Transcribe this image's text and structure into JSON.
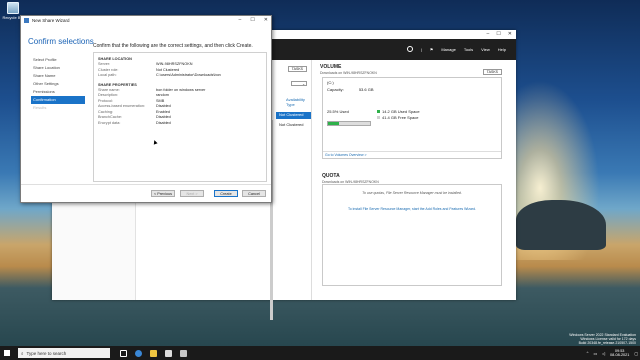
{
  "desktop": {
    "icon_label": "Recycle Bin"
  },
  "wizard": {
    "title": "New Share Wizard",
    "heading": "Confirm selections",
    "intro": "Confirm that the following are the correct settings, and then click Create.",
    "steps": [
      "Select Profile",
      "Share Location",
      "Share Name",
      "Other Settings",
      "Permissions",
      "Confirmation",
      "Results"
    ],
    "active_step": "Confirmation",
    "share_location": {
      "header": "SHARE LOCATION",
      "rows": [
        {
          "k": "Server:",
          "v": "WIN-98HRSZFNOKN"
        },
        {
          "k": "Cluster role:",
          "v": "Not Clustered"
        },
        {
          "k": "Local path:",
          "v": "C:\\users\\Administrator\\Downloads\\bon"
        }
      ]
    },
    "share_properties": {
      "header": "SHARE PROPERTIES",
      "rows": [
        {
          "k": "Share name:",
          "v": "bon folder on windows server"
        },
        {
          "k": "Description:",
          "v": "random"
        },
        {
          "k": "Protocol:",
          "v": "SMB"
        },
        {
          "k": "Access-based enumeration:",
          "v": "Disabled"
        },
        {
          "k": "Caching:",
          "v": "Enabled"
        },
        {
          "k": "BranchCache:",
          "v": "Disabled"
        },
        {
          "k": "Encrypt data:",
          "v": "Disabled"
        }
      ]
    },
    "buttons": {
      "previous": "< Previous",
      "next": "Next >",
      "create": "Create",
      "cancel": "Cancel"
    }
  },
  "server_manager": {
    "menu": {
      "manage": "Manage",
      "tools": "Tools",
      "view": "View",
      "help": "Help"
    },
    "left_panel": {
      "tasks": "TASKS",
      "column": "Availability Type",
      "selected_row": "Not Clustered",
      "row2": "Not Clustered"
    },
    "volume": {
      "title": "VOLUME",
      "subtitle": "Downloads on WIN-98HRSZFNOKN",
      "tasks": "TASKS",
      "drive": "(C:)",
      "capacity_label": "Capacity:",
      "capacity_value": "53.6 GB",
      "used_pct_label": "25.5% Used",
      "used_fraction": 0.255,
      "used_space": "14.2 GB Used Space",
      "free_space": "41.4 GB Free Space",
      "link": "Go to Volumes Overview >",
      "used_color": "#2fb14a",
      "free_color": "#d0d0d0"
    },
    "quota": {
      "title": "QUOTA",
      "subtitle": "Downloads on WIN-98HRSZFNOKN",
      "msg1": "To use quotas, File Server Resource Manager must be installed.",
      "msg2": "To install File Server Resource Manager, start the Add Roles and Features Wizard."
    }
  },
  "taskbar": {
    "search_placeholder": "Type here to search",
    "time": "09:53",
    "date": "08-08-2021"
  },
  "watermark": {
    "line1": "Windows Server 2022 Standard Evaluation",
    "line2": "Windows License valid for 172 days",
    "line3": "Build 20348.fe_release.210507-1500"
  }
}
